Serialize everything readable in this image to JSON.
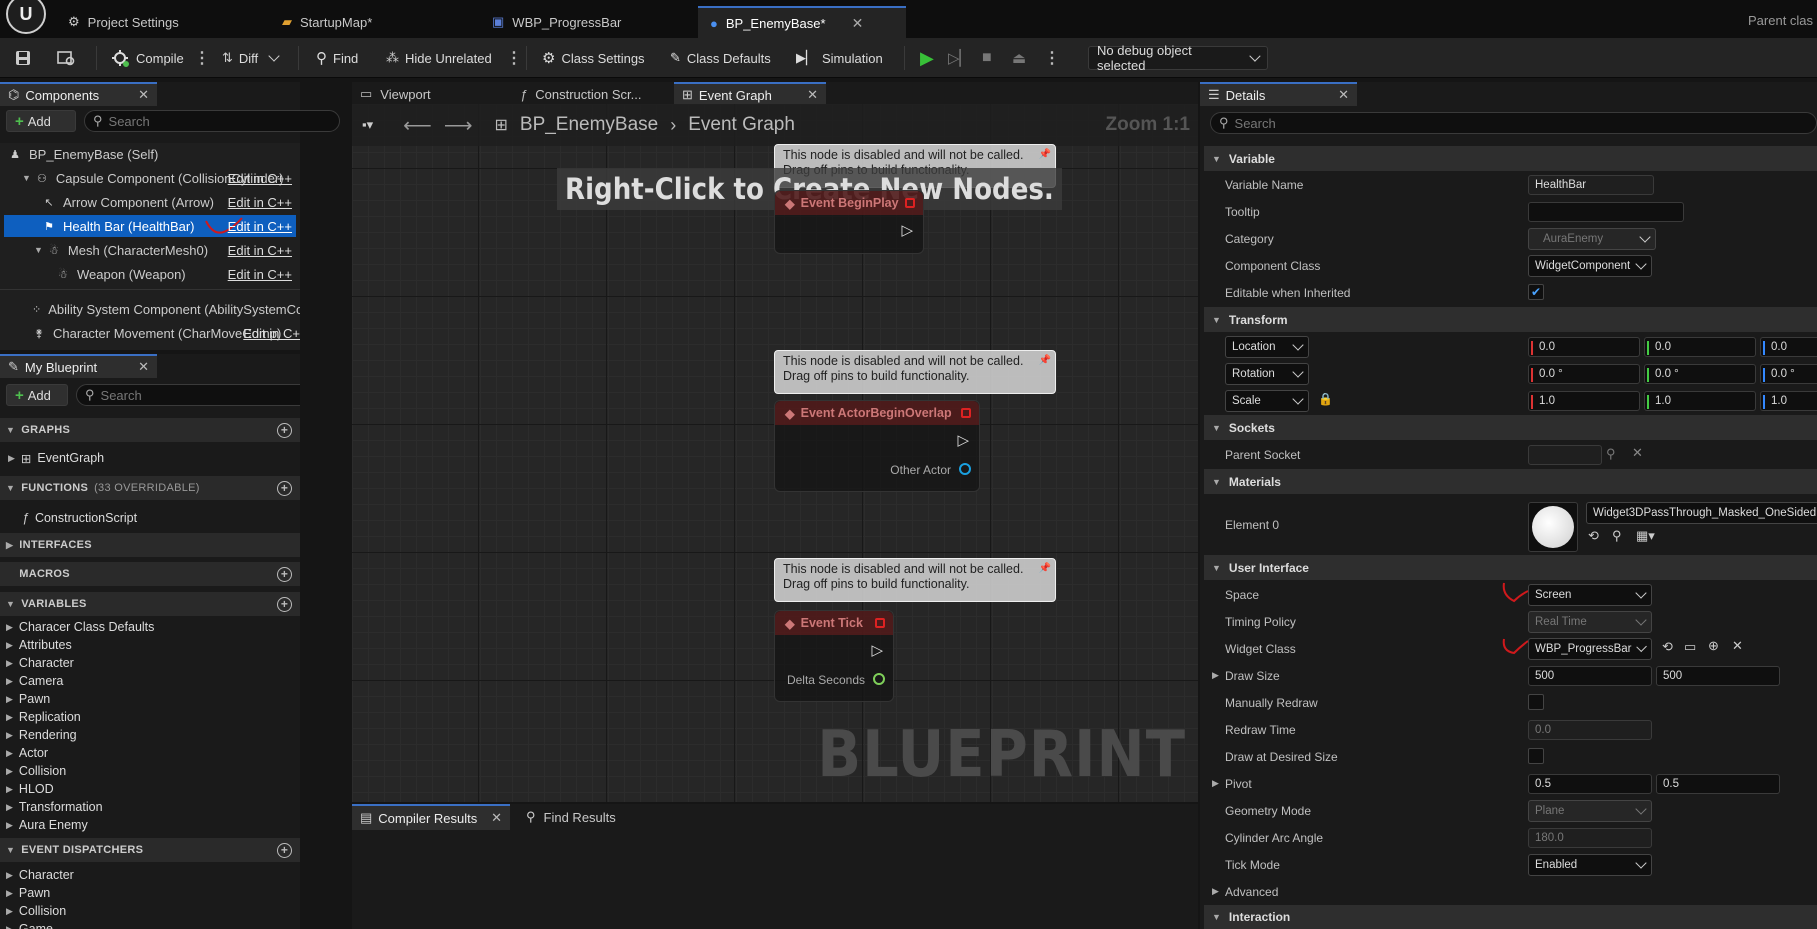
{
  "titlebar": {
    "tabs": [
      {
        "label": "Project Settings"
      },
      {
        "label": "StartupMap*"
      },
      {
        "label": "WBP_ProgressBar"
      },
      {
        "label": "BP_EnemyBase*"
      }
    ],
    "parent_class": "Parent clas"
  },
  "toolbar": {
    "compile": "Compile",
    "diff": "Diff",
    "find": "Find",
    "hide_unrelated": "Hide Unrelated",
    "class_settings": "Class Settings",
    "class_defaults": "Class Defaults",
    "simulation": "Simulation",
    "debug_object": "No debug object selected"
  },
  "components": {
    "title": "Components",
    "add": "Add",
    "search_placeholder": "Search",
    "edit_cpp": "Edit in C++",
    "edit_cpp_cut": "Edit in C+",
    "items": [
      {
        "label": "BP_EnemyBase (Self)"
      },
      {
        "label": "Capsule Component (CollisionCylinder)"
      },
      {
        "label": "Arrow Component (Arrow)"
      },
      {
        "label": "Health Bar (HealthBar)"
      },
      {
        "label": "Mesh (CharacterMesh0)"
      },
      {
        "label": "Weapon (Weapon)"
      },
      {
        "label": "Ability System Component (AbilitySystemCompone"
      },
      {
        "label": "Character Movement (CharMoveComp)"
      }
    ]
  },
  "myblueprint": {
    "title": "My Blueprint",
    "add": "Add",
    "search_placeholder": "Search",
    "graphs": "GRAPHS",
    "event_graph": "EventGraph",
    "functions": "FUNCTIONS",
    "functions_count": "(33 OVERRIDABLE)",
    "construction_script": "ConstructionScript",
    "interfaces": "INTERFACES",
    "macros": "MACROS",
    "variables": "VARIABLES",
    "variable_categories": [
      "Characer Class Defaults",
      "Attributes",
      "Character",
      "Camera",
      "Pawn",
      "Replication",
      "Rendering",
      "Actor",
      "Collision",
      "HLOD",
      "Transformation",
      "Aura Enemy"
    ],
    "event_dispatchers": "EVENT DISPATCHERS",
    "dispatcher_categories": [
      "Character",
      "Pawn",
      "Collision",
      "Game"
    ]
  },
  "graph": {
    "tabs": [
      "Viewport",
      "Construction Scr...",
      "Event Graph"
    ],
    "breadcrumb_root": "BP_EnemyBase",
    "breadcrumb_current": "Event Graph",
    "zoom": "Zoom 1:1",
    "hint": "Right-Click to Create New Nodes.",
    "watermark": "BLUEPRINT",
    "comment_line1": "This node is disabled and will not be called.",
    "comment_line2": "Drag off pins to build functionality.",
    "nodes": [
      {
        "title": "Event BeginPlay"
      },
      {
        "title": "Event ActorBeginOverlap",
        "pin": "Other Actor"
      },
      {
        "title": "Event Tick",
        "pin": "Delta Seconds"
      }
    ]
  },
  "bottom": {
    "compiler_results": "Compiler Results",
    "find_results": "Find Results"
  },
  "details": {
    "title": "Details",
    "search_placeholder": "Search",
    "sections": {
      "variable": "Variable",
      "transform": "Transform",
      "sockets": "Sockets",
      "materials": "Materials",
      "user_interface": "User Interface",
      "interaction": "Interaction"
    },
    "variable_name_label": "Variable Name",
    "variable_name": "HealthBar",
    "tooltip_label": "Tooltip",
    "tooltip": "",
    "category_label": "Category",
    "category": "AuraEnemy",
    "component_class_label": "Component Class",
    "component_class": "WidgetComponent",
    "editable_inherited_label": "Editable when Inherited",
    "location_label": "Location",
    "rotation_label": "Rotation",
    "scale_label": "Scale",
    "location": [
      "0.0",
      "0.0",
      "0.0"
    ],
    "rotation": [
      "0.0 °",
      "0.0 °",
      "0.0 °"
    ],
    "scale": [
      "1.0",
      "1.0",
      "1.0"
    ],
    "parent_socket_label": "Parent Socket",
    "element0_label": "Element 0",
    "material": "Widget3DPassThrough_Masked_OneSided",
    "space_label": "Space",
    "space": "Screen",
    "timing_policy_label": "Timing Policy",
    "timing_policy": "Real Time",
    "widget_class_label": "Widget Class",
    "widget_class": "WBP_ProgressBar",
    "draw_size_label": "Draw Size",
    "draw_size": [
      "500",
      "500"
    ],
    "manually_redraw_label": "Manually Redraw",
    "redraw_time_label": "Redraw Time",
    "redraw_time": "0.0",
    "draw_desired_label": "Draw at Desired Size",
    "pivot_label": "Pivot",
    "pivot": [
      "0.5",
      "0.5"
    ],
    "geometry_mode_label": "Geometry Mode",
    "geometry_mode": "Plane",
    "cylinder_arc_label": "Cylinder Arc Angle",
    "cylinder_arc": "180.0",
    "tick_mode_label": "Tick Mode",
    "tick_mode": "Enabled",
    "advanced_label": "Advanced"
  },
  "colors": {
    "accent": "#3a6fc4",
    "selection": "#0e5fbf",
    "annotation": "#d0191c"
  }
}
